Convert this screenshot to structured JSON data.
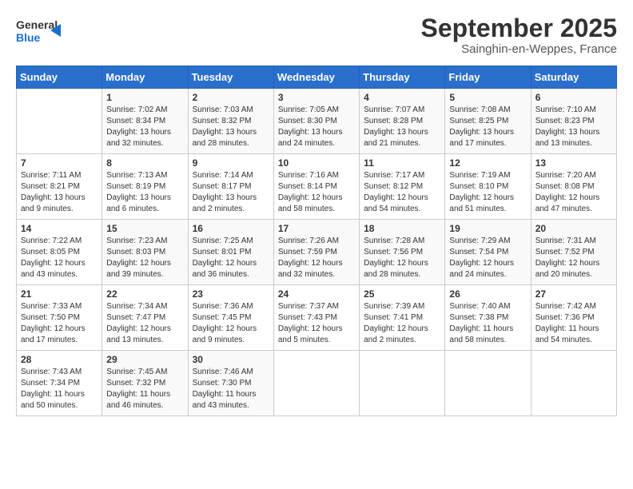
{
  "logo": {
    "general": "General",
    "blue": "Blue"
  },
  "header": {
    "title": "September 2025",
    "subtitle": "Sainghin-en-Weppes, France"
  },
  "weekdays": [
    "Sunday",
    "Monday",
    "Tuesday",
    "Wednesday",
    "Thursday",
    "Friday",
    "Saturday"
  ],
  "weeks": [
    [
      {
        "day": "",
        "sunrise": "",
        "sunset": "",
        "daylight": ""
      },
      {
        "day": "1",
        "sunrise": "Sunrise: 7:02 AM",
        "sunset": "Sunset: 8:34 PM",
        "daylight": "Daylight: 13 hours and 32 minutes."
      },
      {
        "day": "2",
        "sunrise": "Sunrise: 7:03 AM",
        "sunset": "Sunset: 8:32 PM",
        "daylight": "Daylight: 13 hours and 28 minutes."
      },
      {
        "day": "3",
        "sunrise": "Sunrise: 7:05 AM",
        "sunset": "Sunset: 8:30 PM",
        "daylight": "Daylight: 13 hours and 24 minutes."
      },
      {
        "day": "4",
        "sunrise": "Sunrise: 7:07 AM",
        "sunset": "Sunset: 8:28 PM",
        "daylight": "Daylight: 13 hours and 21 minutes."
      },
      {
        "day": "5",
        "sunrise": "Sunrise: 7:08 AM",
        "sunset": "Sunset: 8:25 PM",
        "daylight": "Daylight: 13 hours and 17 minutes."
      },
      {
        "day": "6",
        "sunrise": "Sunrise: 7:10 AM",
        "sunset": "Sunset: 8:23 PM",
        "daylight": "Daylight: 13 hours and 13 minutes."
      }
    ],
    [
      {
        "day": "7",
        "sunrise": "Sunrise: 7:11 AM",
        "sunset": "Sunset: 8:21 PM",
        "daylight": "Daylight: 13 hours and 9 minutes."
      },
      {
        "day": "8",
        "sunrise": "Sunrise: 7:13 AM",
        "sunset": "Sunset: 8:19 PM",
        "daylight": "Daylight: 13 hours and 6 minutes."
      },
      {
        "day": "9",
        "sunrise": "Sunrise: 7:14 AM",
        "sunset": "Sunset: 8:17 PM",
        "daylight": "Daylight: 13 hours and 2 minutes."
      },
      {
        "day": "10",
        "sunrise": "Sunrise: 7:16 AM",
        "sunset": "Sunset: 8:14 PM",
        "daylight": "Daylight: 12 hours and 58 minutes."
      },
      {
        "day": "11",
        "sunrise": "Sunrise: 7:17 AM",
        "sunset": "Sunset: 8:12 PM",
        "daylight": "Daylight: 12 hours and 54 minutes."
      },
      {
        "day": "12",
        "sunrise": "Sunrise: 7:19 AM",
        "sunset": "Sunset: 8:10 PM",
        "daylight": "Daylight: 12 hours and 51 minutes."
      },
      {
        "day": "13",
        "sunrise": "Sunrise: 7:20 AM",
        "sunset": "Sunset: 8:08 PM",
        "daylight": "Daylight: 12 hours and 47 minutes."
      }
    ],
    [
      {
        "day": "14",
        "sunrise": "Sunrise: 7:22 AM",
        "sunset": "Sunset: 8:05 PM",
        "daylight": "Daylight: 12 hours and 43 minutes."
      },
      {
        "day": "15",
        "sunrise": "Sunrise: 7:23 AM",
        "sunset": "Sunset: 8:03 PM",
        "daylight": "Daylight: 12 hours and 39 minutes."
      },
      {
        "day": "16",
        "sunrise": "Sunrise: 7:25 AM",
        "sunset": "Sunset: 8:01 PM",
        "daylight": "Daylight: 12 hours and 36 minutes."
      },
      {
        "day": "17",
        "sunrise": "Sunrise: 7:26 AM",
        "sunset": "Sunset: 7:59 PM",
        "daylight": "Daylight: 12 hours and 32 minutes."
      },
      {
        "day": "18",
        "sunrise": "Sunrise: 7:28 AM",
        "sunset": "Sunset: 7:56 PM",
        "daylight": "Daylight: 12 hours and 28 minutes."
      },
      {
        "day": "19",
        "sunrise": "Sunrise: 7:29 AM",
        "sunset": "Sunset: 7:54 PM",
        "daylight": "Daylight: 12 hours and 24 minutes."
      },
      {
        "day": "20",
        "sunrise": "Sunrise: 7:31 AM",
        "sunset": "Sunset: 7:52 PM",
        "daylight": "Daylight: 12 hours and 20 minutes."
      }
    ],
    [
      {
        "day": "21",
        "sunrise": "Sunrise: 7:33 AM",
        "sunset": "Sunset: 7:50 PM",
        "daylight": "Daylight: 12 hours and 17 minutes."
      },
      {
        "day": "22",
        "sunrise": "Sunrise: 7:34 AM",
        "sunset": "Sunset: 7:47 PM",
        "daylight": "Daylight: 12 hours and 13 minutes."
      },
      {
        "day": "23",
        "sunrise": "Sunrise: 7:36 AM",
        "sunset": "Sunset: 7:45 PM",
        "daylight": "Daylight: 12 hours and 9 minutes."
      },
      {
        "day": "24",
        "sunrise": "Sunrise: 7:37 AM",
        "sunset": "Sunset: 7:43 PM",
        "daylight": "Daylight: 12 hours and 5 minutes."
      },
      {
        "day": "25",
        "sunrise": "Sunrise: 7:39 AM",
        "sunset": "Sunset: 7:41 PM",
        "daylight": "Daylight: 12 hours and 2 minutes."
      },
      {
        "day": "26",
        "sunrise": "Sunrise: 7:40 AM",
        "sunset": "Sunset: 7:38 PM",
        "daylight": "Daylight: 11 hours and 58 minutes."
      },
      {
        "day": "27",
        "sunrise": "Sunrise: 7:42 AM",
        "sunset": "Sunset: 7:36 PM",
        "daylight": "Daylight: 11 hours and 54 minutes."
      }
    ],
    [
      {
        "day": "28",
        "sunrise": "Sunrise: 7:43 AM",
        "sunset": "Sunset: 7:34 PM",
        "daylight": "Daylight: 11 hours and 50 minutes."
      },
      {
        "day": "29",
        "sunrise": "Sunrise: 7:45 AM",
        "sunset": "Sunset: 7:32 PM",
        "daylight": "Daylight: 11 hours and 46 minutes."
      },
      {
        "day": "30",
        "sunrise": "Sunrise: 7:46 AM",
        "sunset": "Sunset: 7:30 PM",
        "daylight": "Daylight: 11 hours and 43 minutes."
      },
      {
        "day": "",
        "sunrise": "",
        "sunset": "",
        "daylight": ""
      },
      {
        "day": "",
        "sunrise": "",
        "sunset": "",
        "daylight": ""
      },
      {
        "day": "",
        "sunrise": "",
        "sunset": "",
        "daylight": ""
      },
      {
        "day": "",
        "sunrise": "",
        "sunset": "",
        "daylight": ""
      }
    ]
  ]
}
